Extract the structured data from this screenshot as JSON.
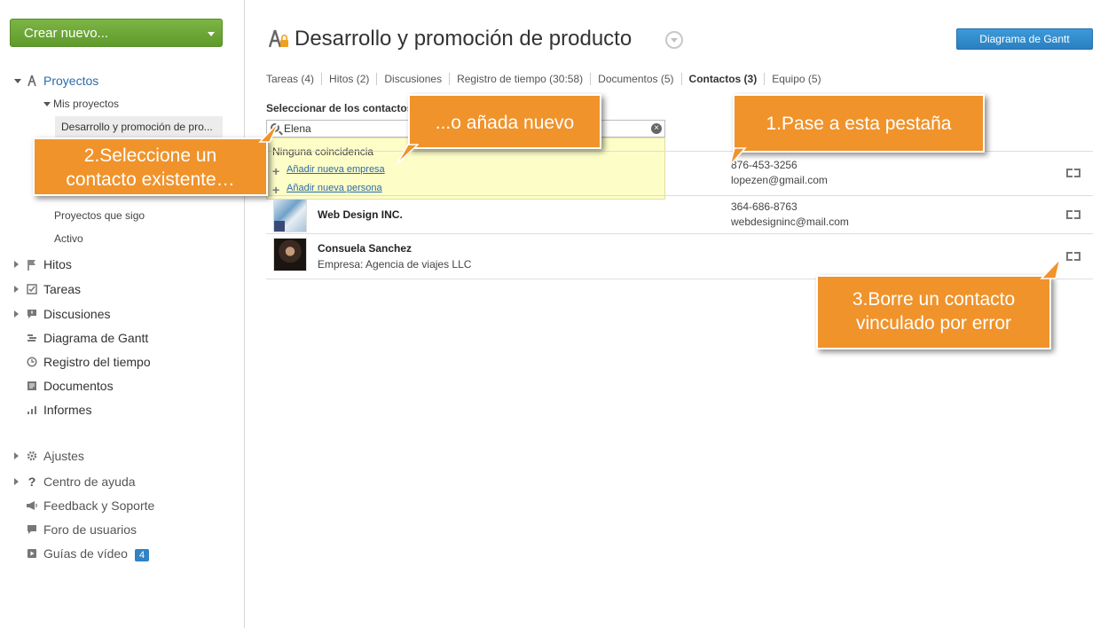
{
  "sidebar": {
    "create_button": "Crear nuevo...",
    "projects": "Proyectos",
    "my_projects": "Mis proyectos",
    "selected_project": "Desarrollo y promoción de pro...",
    "followed_projects": "Proyectos que sigo",
    "active": "Activo",
    "milestones": "Hitos",
    "tasks": "Tareas",
    "discussions": "Discusiones",
    "gantt": "Diagrama de Gantt",
    "time_log": "Registro del tiempo",
    "documents": "Documentos",
    "reports": "Informes",
    "settings": "Ajustes",
    "help_center": "Centro de ayuda",
    "feedback": "Feedback y Soporte",
    "user_forum": "Foro de usuarios",
    "video_guides": "Guías de vídeo",
    "video_guides_count": "4"
  },
  "header": {
    "title": "Desarrollo y promoción de producto",
    "gantt_button": "Diagrama de Gantt"
  },
  "tabs": [
    {
      "label": "Tareas (4)"
    },
    {
      "label": "Hitos (2)"
    },
    {
      "label": "Discusiones"
    },
    {
      "label": "Registro de tiempo (30:58)"
    },
    {
      "label": "Documentos (5)"
    },
    {
      "label": "Contactos (3)"
    },
    {
      "label": "Equipo (5)"
    }
  ],
  "contacts_panel": {
    "select_label": "Seleccionar de los contactos",
    "search_value": "Elena",
    "no_match": "Ninguna coincidencia",
    "add_company": "Añadir nueva empresa",
    "add_person": "Añadir nueva persona"
  },
  "contacts": [
    {
      "name": "",
      "subtitle": "",
      "phone": "876-453-3256",
      "email": "lopezen@gmail.com"
    },
    {
      "name": "Web Design INC.",
      "subtitle": "",
      "phone": "364-686-8763",
      "email": "webdesigninc@mail.com"
    },
    {
      "name": "Consuela Sanchez",
      "subtitle": "Empresa: Agencia de viajes LLC",
      "phone": "",
      "email": ""
    }
  ],
  "callouts": {
    "step1": "1.Pase a esta pestaña",
    "step2_line1": "2.Seleccione un",
    "step2_line2": "contacto existente…",
    "or_add": "...o añada nuevo",
    "step3_line1": "3.Borre un contacto",
    "step3_line2": "vinculado por error"
  },
  "colors": {
    "accent_green": "#6aa835",
    "callout_orange": "#f0932b",
    "button_blue": "#2f83c6",
    "dropdown_yellow": "#fdfdc8"
  }
}
